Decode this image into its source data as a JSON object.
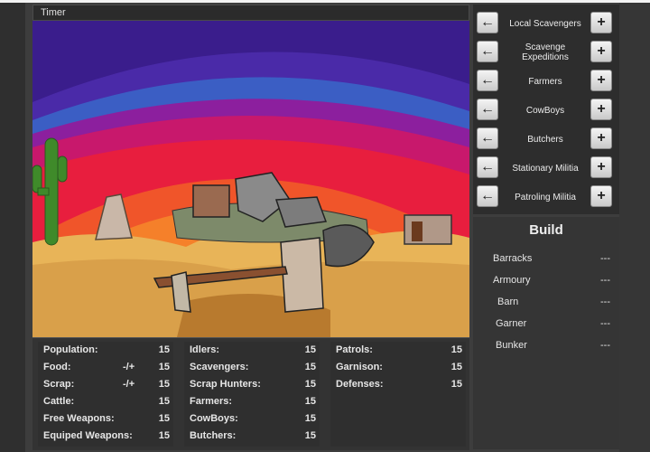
{
  "header": {
    "title": "Timer"
  },
  "stats": {
    "col1": [
      {
        "label": "Population:",
        "adj": "",
        "value": "15"
      },
      {
        "label": "Food:",
        "adj": "-/+",
        "value": "15"
      },
      {
        "label": "Scrap:",
        "adj": "-/+",
        "value": "15"
      },
      {
        "label": "Cattle:",
        "adj": "",
        "value": "15"
      },
      {
        "label": "Free Weapons:",
        "adj": "",
        "value": "15"
      },
      {
        "label": "Equiped Weapons:",
        "adj": "",
        "value": "15"
      }
    ],
    "col2": [
      {
        "label": "Idlers:",
        "value": "15"
      },
      {
        "label": "Scavengers:",
        "value": "15"
      },
      {
        "label": "Scrap Hunters:",
        "value": "15"
      },
      {
        "label": "Farmers:",
        "value": "15"
      },
      {
        "label": "CowBoys:",
        "value": "15"
      },
      {
        "label": "Butchers:",
        "value": "15"
      }
    ],
    "col3": [
      {
        "label": "Patrols:",
        "value": "15"
      },
      {
        "label": "Garnison:",
        "value": "15"
      },
      {
        "label": "Defenses:",
        "value": "15"
      }
    ]
  },
  "workers": {
    "minus_glyph": "←",
    "plus_glyph": "+",
    "items": [
      {
        "label": "Local Scavengers"
      },
      {
        "label": "Scavenge Expeditions"
      },
      {
        "label": "Farmers"
      },
      {
        "label": "CowBoys"
      },
      {
        "label": "Butchers"
      },
      {
        "label": "Stationary Militia"
      },
      {
        "label": "Patroling Militia"
      }
    ]
  },
  "build": {
    "title": "Build",
    "items": [
      {
        "name": "Barracks",
        "status": "---"
      },
      {
        "name": "Armoury",
        "status": "---"
      },
      {
        "name": "Barn",
        "status": "---"
      },
      {
        "name": "Garner",
        "status": "---"
      },
      {
        "name": "Bunker",
        "status": "---"
      }
    ]
  },
  "colors": {
    "background": "#3d3d3d",
    "sky_top": "#3a1d8c",
    "sky_mid": "#c8186c",
    "sky_low": "#f06020",
    "sand": "#e8b458",
    "cactus": "#3f8a2a"
  }
}
